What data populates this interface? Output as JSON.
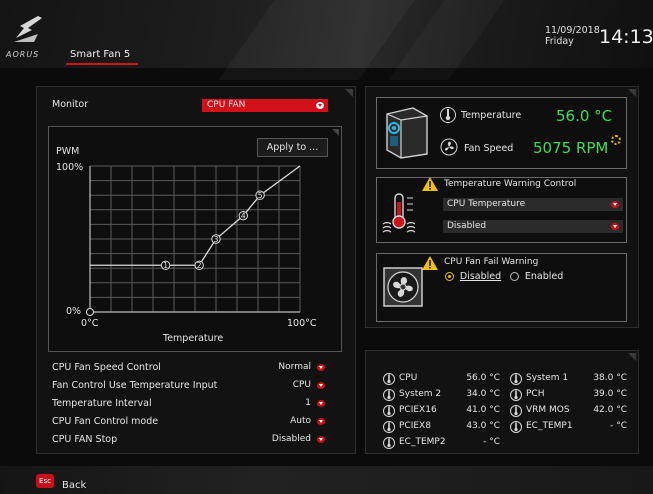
{
  "header": {
    "tab": "Smart Fan 5",
    "date": "11/09/2018",
    "day": "Friday",
    "time": "14:13",
    "logo_text": "AORUS"
  },
  "monitor": {
    "label": "Monitor",
    "value": "CPU FAN"
  },
  "curve": {
    "apply_label": "Apply to ...",
    "y_axis_label": "PWM",
    "y_top_label": "100%",
    "y_bottom_label": "0%",
    "x_left_label": "0°C",
    "x_right_label": "100°C",
    "x_axis_label": "Temperature",
    "point_labels": [
      "1",
      "2",
      "3",
      "4",
      "5"
    ],
    "points": [
      {
        "temp": 36,
        "pwm": 32
      },
      {
        "temp": 52,
        "pwm": 32
      },
      {
        "temp": 60,
        "pwm": 50
      },
      {
        "temp": 73,
        "pwm": 66
      },
      {
        "temp": 81,
        "pwm": 80
      },
      {
        "temp": 100,
        "pwm": 100
      }
    ]
  },
  "settings": [
    {
      "label": "CPU Fan Speed Control",
      "value": "Normal"
    },
    {
      "label": "Fan Control Use Temperature Input",
      "value": "CPU"
    },
    {
      "label": "Temperature Interval",
      "value": "1"
    },
    {
      "label": "CPU Fan Control mode",
      "value": "Auto"
    },
    {
      "label": "CPU FAN Stop",
      "value": "Disabled"
    }
  ],
  "status": {
    "temp_label": "Temperature",
    "temp_value": "56.0 °C",
    "fan_label": "Fan Speed",
    "fan_value": "5075 RPM"
  },
  "temp_warning": {
    "title": "Temperature Warning Control",
    "source": "CPU Temperature",
    "value": "Disabled"
  },
  "fan_fail": {
    "title": "CPU Fan Fail Warning",
    "option_disabled": "Disabled",
    "option_enabled": "Enabled",
    "selected": "Disabled"
  },
  "sensors": [
    {
      "name": "CPU",
      "value": "56.0 °C"
    },
    {
      "name": "System 1",
      "value": "38.0 °C"
    },
    {
      "name": "System 2",
      "value": "34.0 °C"
    },
    {
      "name": "PCH",
      "value": "39.0 °C"
    },
    {
      "name": "PCIEX16",
      "value": "41.0 °C"
    },
    {
      "name": "VRM MOS",
      "value": "42.0 °C"
    },
    {
      "name": "PCIEX8",
      "value": "43.0 °C"
    },
    {
      "name": "EC_TEMP1",
      "value": "- °C"
    },
    {
      "name": "EC_TEMP2",
      "value": "- °C"
    }
  ],
  "footer": {
    "esc_key": "Esc",
    "back_label": "Back"
  },
  "colors": {
    "accent": "#d2111a",
    "value_green": "#3ddc5a",
    "warning_yellow": "#f2c200"
  }
}
